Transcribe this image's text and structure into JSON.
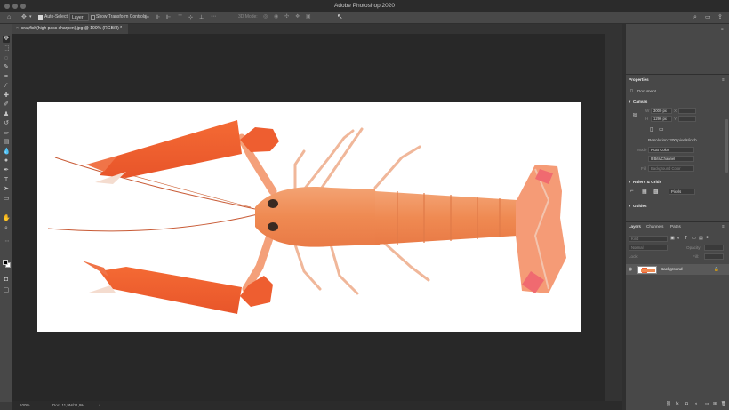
{
  "app": {
    "title": "Adobe Photoshop 2020"
  },
  "options_bar": {
    "auto_select_label": "Auto-Select:",
    "auto_select_checked": true,
    "auto_select_value": "Layer",
    "show_transform_label": "Show Transform Controls",
    "mode_3d_label": "3D Mode:"
  },
  "document": {
    "tab_label": "crayfish(high pass sharpen).jpg @ 100% (RGB/8) *",
    "zoom": "100%",
    "doc_info": "Doc: 11,9M/11,9M"
  },
  "properties": {
    "tab": "Properties",
    "doc_label": "Document",
    "canvas_heading": "Canvas",
    "w_label": "W",
    "w_value": "3000 px",
    "h_label": "H",
    "h_value": "1296 px",
    "x_label": "X",
    "y_label": "Y",
    "resolution": "Resolution: 300 pixels/inch",
    "mode_label": "Mode",
    "mode_value": "RGB Color",
    "bits_value": "8 Bits/Channel",
    "fill_label": "Fill",
    "fill_value": "Background Color",
    "rulers_heading": "Rulers & Grids",
    "rulers_unit": "Pixels",
    "guides_heading": "Guides"
  },
  "layers_panel": {
    "tabs": [
      "Layers",
      "Channels",
      "Paths"
    ],
    "kind_placeholder": "Kind",
    "blend_mode": "Normal",
    "opacity_label": "Opacity:",
    "lock_label": "Lock:",
    "fill_label": "Fill:",
    "layer_name": "Background"
  },
  "colors": {
    "panel_bg": "#484848",
    "canvas_bg": "#282828",
    "crayfish": "#f08050"
  }
}
